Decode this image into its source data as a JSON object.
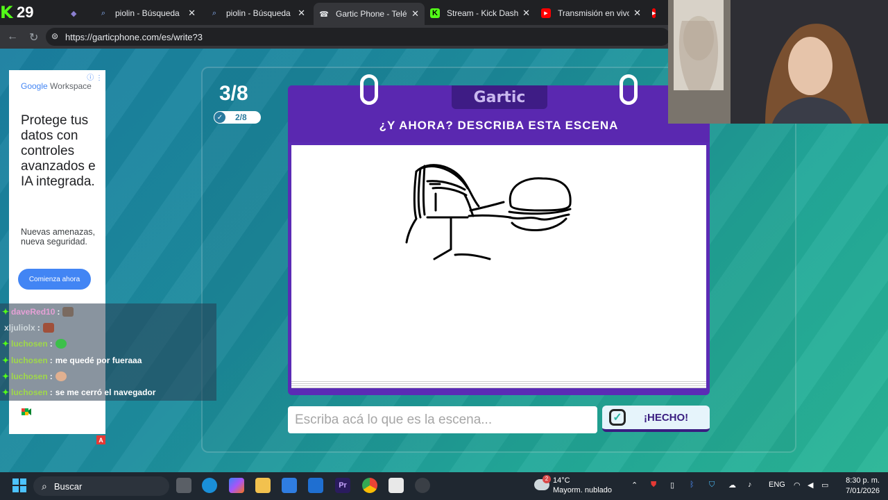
{
  "browser": {
    "counter": "29",
    "tabs": [
      {
        "title": "piolin - Búsqueda",
        "icon": "search-icon"
      },
      {
        "title": "piolin - Búsqueda Imágenes",
        "icon": "search-icon"
      },
      {
        "title": "Gartic Phone - Teléfono sin hilos",
        "icon": "gartic-icon",
        "active": true
      },
      {
        "title": "Stream - Kick Dashboard",
        "icon": "kick-icon"
      },
      {
        "title": "Transmisión en vivo - YouTube",
        "icon": "youtube-icon"
      }
    ],
    "url": "https://garticphone.com/es/write?3"
  },
  "game": {
    "round": "3/8",
    "progress": "2/8",
    "logo": "Gartic",
    "prompt_title": "¿Y AHORA? DESCRIBA ESTA ESCENA",
    "input_placeholder": "Escriba acá lo que es la escena...",
    "done_label": "¡HECHO!"
  },
  "ad": {
    "brand_google": "Google",
    "brand_workspace": "Workspace",
    "headline": "Protege tus datos con controles avanzados e IA integrada.",
    "subtext": "Nuevas amenazas, nueva seguridad.",
    "cta": "Comienza ahora",
    "badge": "A"
  },
  "chat": {
    "messages": [
      {
        "user": "daveRed10",
        "text": "",
        "color": "pink",
        "emote": true
      },
      {
        "user": "xljuliolx",
        "text": "",
        "color": "grey",
        "emote": true
      },
      {
        "user": "luchosen",
        "text": "",
        "color": "green",
        "emote": true
      },
      {
        "user": "luchosen",
        "text": "me quedé por fueraaa",
        "color": "green",
        "emote": false
      },
      {
        "user": "luchosen",
        "text": "",
        "color": "green",
        "emote": true
      },
      {
        "user": "luchosen",
        "text": "se me cerró el navegador",
        "color": "green",
        "emote": false
      }
    ]
  },
  "taskbar": {
    "search": "Buscar",
    "weather_temp": "14°C",
    "weather_desc": "Mayorm. nublado",
    "weather_badge": "2",
    "lang": "ENG",
    "time": "8:30 p. m.",
    "date": "7/01/2026"
  }
}
